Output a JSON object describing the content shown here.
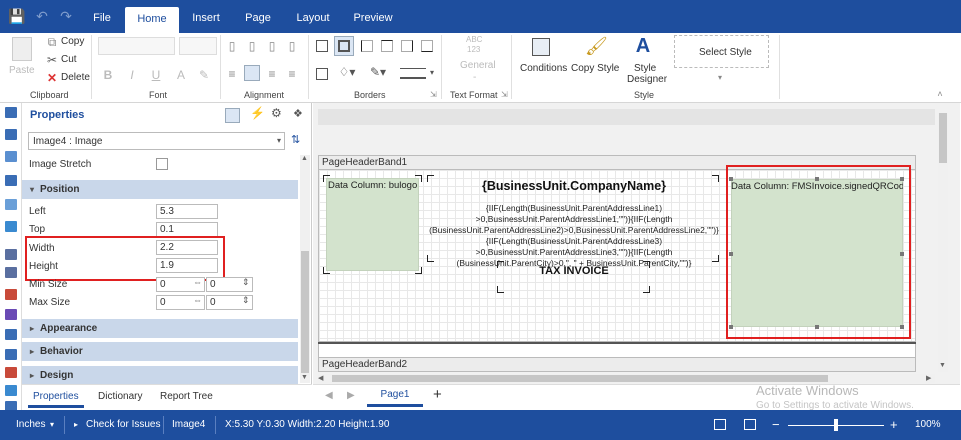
{
  "menu": {
    "tabs": [
      "File",
      "Home",
      "Insert",
      "Page",
      "Layout",
      "Preview"
    ],
    "active": "Home"
  },
  "ribbon": {
    "clipboard": {
      "paste": "Paste",
      "copy": "Copy",
      "cut": "Cut",
      "delete": "Delete",
      "label": "Clipboard"
    },
    "font": {
      "label": "Font"
    },
    "alignment": {
      "label": "Alignment"
    },
    "borders": {
      "label": "Borders"
    },
    "text_format": {
      "abc": "ABC",
      "num": "123",
      "general": "General",
      "label": "Text Format"
    },
    "style": {
      "conditions": "Conditions",
      "copy_style": "Copy Style",
      "style_designer_1": "Style",
      "style_designer_2": "Designer",
      "select_style": "Select Style",
      "label": "Style"
    }
  },
  "properties": {
    "title": "Properties",
    "component": "Image4 : Image",
    "image_stretch": "Image Stretch",
    "position_section": "Position",
    "left_label": "Left",
    "left_value": "5.3",
    "top_label": "Top",
    "top_value": "0.1",
    "width_label": "Width",
    "width_value": "2.2",
    "height_label": "Height",
    "height_value": "1.9",
    "min_size": "Min Size",
    "min_w": "0",
    "min_h": "0",
    "max_size": "Max Size",
    "max_w": "0",
    "max_h": "0",
    "appearance": "Appearance",
    "behavior": "Behavior",
    "design": "Design",
    "tabs": [
      "Properties",
      "Dictionary",
      "Report Tree"
    ]
  },
  "design": {
    "band1": "PageHeaderBand1",
    "band2": "PageHeaderBand2",
    "logo_label": "Data Column: bulogo",
    "qr_label": "Data Column: FMSInvoice.signedQRCod",
    "company_name": "{BusinessUnit.CompanyName}",
    "address_lines": [
      "{IIF(Length(BusinessUnit.ParentAddressLine1)",
      ">0,BusinessUnit.ParentAddressLine1,\"\")}{IIF(Length",
      "(BusinessUnit.ParentAddressLine2)>0,BusinessUnit.ParentAddressLine2,\"\")}",
      "{IIF(Length(BusinessUnit.ParentAddressLine3)",
      ">0,BusinessUnit.ParentAddressLine3,\"\")}{IIF(Length",
      "(BusinessUnit.ParentCity)>0,\", \" + BusinessUnit.ParentCity,\"\")}"
    ],
    "tax_invoice": "TAX INVOICE",
    "page_tab": "Page1",
    "add_page": "+"
  },
  "watermark": {
    "line1": "Activate Windows",
    "line2": "Go to Settings to activate Windows."
  },
  "status": {
    "units": "Inches",
    "check_issues": "Check for Issues",
    "component": "Image4",
    "coords": "X:5.30 Y:0.30 Width:2.20 Height:1.90",
    "zoom": "100%"
  },
  "colors": {
    "accent": "#1e4e9e",
    "highlight": "#e02020",
    "section": "#c9d7ea",
    "image_fill": "#d3e3cd"
  }
}
